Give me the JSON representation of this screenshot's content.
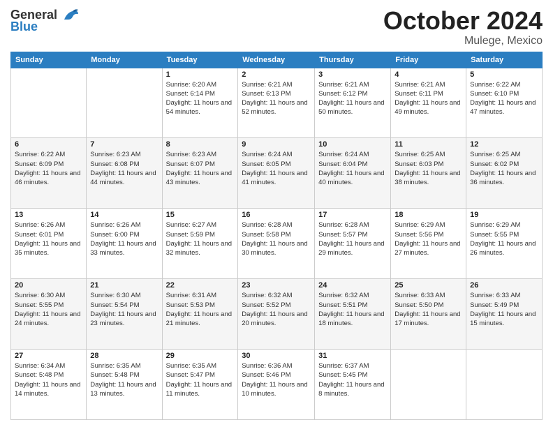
{
  "header": {
    "logo_general": "General",
    "logo_blue": "Blue",
    "month_title": "October 2024",
    "location": "Mulege, Mexico"
  },
  "weekdays": [
    "Sunday",
    "Monday",
    "Tuesday",
    "Wednesday",
    "Thursday",
    "Friday",
    "Saturday"
  ],
  "weeks": [
    [
      null,
      null,
      {
        "day": 1,
        "sunrise": "6:20 AM",
        "sunset": "6:14 PM",
        "daylight": "11 hours and 54 minutes."
      },
      {
        "day": 2,
        "sunrise": "6:21 AM",
        "sunset": "6:13 PM",
        "daylight": "11 hours and 52 minutes."
      },
      {
        "day": 3,
        "sunrise": "6:21 AM",
        "sunset": "6:12 PM",
        "daylight": "11 hours and 50 minutes."
      },
      {
        "day": 4,
        "sunrise": "6:21 AM",
        "sunset": "6:11 PM",
        "daylight": "11 hours and 49 minutes."
      },
      {
        "day": 5,
        "sunrise": "6:22 AM",
        "sunset": "6:10 PM",
        "daylight": "11 hours and 47 minutes."
      }
    ],
    [
      {
        "day": 6,
        "sunrise": "6:22 AM",
        "sunset": "6:09 PM",
        "daylight": "11 hours and 46 minutes."
      },
      {
        "day": 7,
        "sunrise": "6:23 AM",
        "sunset": "6:08 PM",
        "daylight": "11 hours and 44 minutes."
      },
      {
        "day": 8,
        "sunrise": "6:23 AM",
        "sunset": "6:07 PM",
        "daylight": "11 hours and 43 minutes."
      },
      {
        "day": 9,
        "sunrise": "6:24 AM",
        "sunset": "6:05 PM",
        "daylight": "11 hours and 41 minutes."
      },
      {
        "day": 10,
        "sunrise": "6:24 AM",
        "sunset": "6:04 PM",
        "daylight": "11 hours and 40 minutes."
      },
      {
        "day": 11,
        "sunrise": "6:25 AM",
        "sunset": "6:03 PM",
        "daylight": "11 hours and 38 minutes."
      },
      {
        "day": 12,
        "sunrise": "6:25 AM",
        "sunset": "6:02 PM",
        "daylight": "11 hours and 36 minutes."
      }
    ],
    [
      {
        "day": 13,
        "sunrise": "6:26 AM",
        "sunset": "6:01 PM",
        "daylight": "11 hours and 35 minutes."
      },
      {
        "day": 14,
        "sunrise": "6:26 AM",
        "sunset": "6:00 PM",
        "daylight": "11 hours and 33 minutes."
      },
      {
        "day": 15,
        "sunrise": "6:27 AM",
        "sunset": "5:59 PM",
        "daylight": "11 hours and 32 minutes."
      },
      {
        "day": 16,
        "sunrise": "6:28 AM",
        "sunset": "5:58 PM",
        "daylight": "11 hours and 30 minutes."
      },
      {
        "day": 17,
        "sunrise": "6:28 AM",
        "sunset": "5:57 PM",
        "daylight": "11 hours and 29 minutes."
      },
      {
        "day": 18,
        "sunrise": "6:29 AM",
        "sunset": "5:56 PM",
        "daylight": "11 hours and 27 minutes."
      },
      {
        "day": 19,
        "sunrise": "6:29 AM",
        "sunset": "5:55 PM",
        "daylight": "11 hours and 26 minutes."
      }
    ],
    [
      {
        "day": 20,
        "sunrise": "6:30 AM",
        "sunset": "5:55 PM",
        "daylight": "11 hours and 24 minutes."
      },
      {
        "day": 21,
        "sunrise": "6:30 AM",
        "sunset": "5:54 PM",
        "daylight": "11 hours and 23 minutes."
      },
      {
        "day": 22,
        "sunrise": "6:31 AM",
        "sunset": "5:53 PM",
        "daylight": "11 hours and 21 minutes."
      },
      {
        "day": 23,
        "sunrise": "6:32 AM",
        "sunset": "5:52 PM",
        "daylight": "11 hours and 20 minutes."
      },
      {
        "day": 24,
        "sunrise": "6:32 AM",
        "sunset": "5:51 PM",
        "daylight": "11 hours and 18 minutes."
      },
      {
        "day": 25,
        "sunrise": "6:33 AM",
        "sunset": "5:50 PM",
        "daylight": "11 hours and 17 minutes."
      },
      {
        "day": 26,
        "sunrise": "6:33 AM",
        "sunset": "5:49 PM",
        "daylight": "11 hours and 15 minutes."
      }
    ],
    [
      {
        "day": 27,
        "sunrise": "6:34 AM",
        "sunset": "5:48 PM",
        "daylight": "11 hours and 14 minutes."
      },
      {
        "day": 28,
        "sunrise": "6:35 AM",
        "sunset": "5:48 PM",
        "daylight": "11 hours and 13 minutes."
      },
      {
        "day": 29,
        "sunrise": "6:35 AM",
        "sunset": "5:47 PM",
        "daylight": "11 hours and 11 minutes."
      },
      {
        "day": 30,
        "sunrise": "6:36 AM",
        "sunset": "5:46 PM",
        "daylight": "11 hours and 10 minutes."
      },
      {
        "day": 31,
        "sunrise": "6:37 AM",
        "sunset": "5:45 PM",
        "daylight": "11 hours and 8 minutes."
      },
      null,
      null
    ]
  ],
  "labels": {
    "sunrise_label": "Sunrise: ",
    "sunset_label": "Sunset: ",
    "daylight_label": "Daylight: "
  }
}
